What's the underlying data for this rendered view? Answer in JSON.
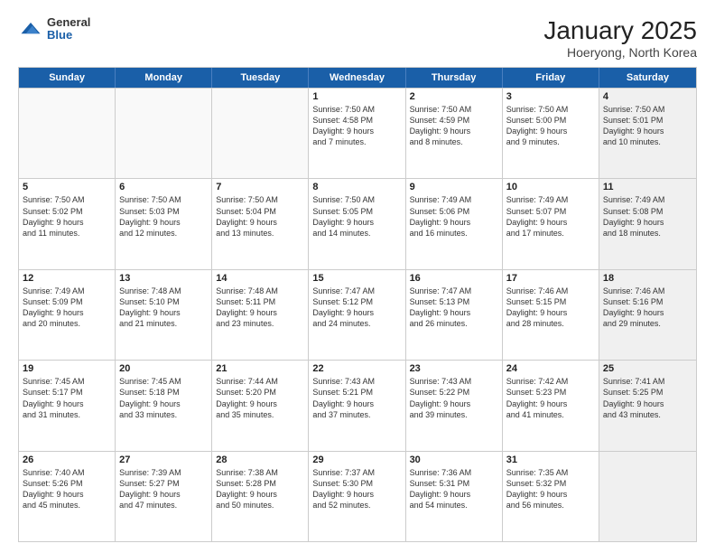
{
  "header": {
    "logo_general": "General",
    "logo_blue": "Blue",
    "title": "January 2025",
    "subtitle": "Hoeryong, North Korea"
  },
  "weekdays": [
    "Sunday",
    "Monday",
    "Tuesday",
    "Wednesday",
    "Thursday",
    "Friday",
    "Saturday"
  ],
  "weeks": [
    [
      {
        "day": "",
        "lines": [],
        "empty": true
      },
      {
        "day": "",
        "lines": [],
        "empty": true
      },
      {
        "day": "",
        "lines": [],
        "empty": true
      },
      {
        "day": "1",
        "lines": [
          "Sunrise: 7:50 AM",
          "Sunset: 4:58 PM",
          "Daylight: 9 hours",
          "and 7 minutes."
        ],
        "empty": false
      },
      {
        "day": "2",
        "lines": [
          "Sunrise: 7:50 AM",
          "Sunset: 4:59 PM",
          "Daylight: 9 hours",
          "and 8 minutes."
        ],
        "empty": false
      },
      {
        "day": "3",
        "lines": [
          "Sunrise: 7:50 AM",
          "Sunset: 5:00 PM",
          "Daylight: 9 hours",
          "and 9 minutes."
        ],
        "empty": false
      },
      {
        "day": "4",
        "lines": [
          "Sunrise: 7:50 AM",
          "Sunset: 5:01 PM",
          "Daylight: 9 hours",
          "and 10 minutes."
        ],
        "empty": false,
        "shaded": true
      }
    ],
    [
      {
        "day": "5",
        "lines": [
          "Sunrise: 7:50 AM",
          "Sunset: 5:02 PM",
          "Daylight: 9 hours",
          "and 11 minutes."
        ],
        "empty": false
      },
      {
        "day": "6",
        "lines": [
          "Sunrise: 7:50 AM",
          "Sunset: 5:03 PM",
          "Daylight: 9 hours",
          "and 12 minutes."
        ],
        "empty": false
      },
      {
        "day": "7",
        "lines": [
          "Sunrise: 7:50 AM",
          "Sunset: 5:04 PM",
          "Daylight: 9 hours",
          "and 13 minutes."
        ],
        "empty": false
      },
      {
        "day": "8",
        "lines": [
          "Sunrise: 7:50 AM",
          "Sunset: 5:05 PM",
          "Daylight: 9 hours",
          "and 14 minutes."
        ],
        "empty": false
      },
      {
        "day": "9",
        "lines": [
          "Sunrise: 7:49 AM",
          "Sunset: 5:06 PM",
          "Daylight: 9 hours",
          "and 16 minutes."
        ],
        "empty": false
      },
      {
        "day": "10",
        "lines": [
          "Sunrise: 7:49 AM",
          "Sunset: 5:07 PM",
          "Daylight: 9 hours",
          "and 17 minutes."
        ],
        "empty": false
      },
      {
        "day": "11",
        "lines": [
          "Sunrise: 7:49 AM",
          "Sunset: 5:08 PM",
          "Daylight: 9 hours",
          "and 18 minutes."
        ],
        "empty": false,
        "shaded": true
      }
    ],
    [
      {
        "day": "12",
        "lines": [
          "Sunrise: 7:49 AM",
          "Sunset: 5:09 PM",
          "Daylight: 9 hours",
          "and 20 minutes."
        ],
        "empty": false
      },
      {
        "day": "13",
        "lines": [
          "Sunrise: 7:48 AM",
          "Sunset: 5:10 PM",
          "Daylight: 9 hours",
          "and 21 minutes."
        ],
        "empty": false
      },
      {
        "day": "14",
        "lines": [
          "Sunrise: 7:48 AM",
          "Sunset: 5:11 PM",
          "Daylight: 9 hours",
          "and 23 minutes."
        ],
        "empty": false
      },
      {
        "day": "15",
        "lines": [
          "Sunrise: 7:47 AM",
          "Sunset: 5:12 PM",
          "Daylight: 9 hours",
          "and 24 minutes."
        ],
        "empty": false
      },
      {
        "day": "16",
        "lines": [
          "Sunrise: 7:47 AM",
          "Sunset: 5:13 PM",
          "Daylight: 9 hours",
          "and 26 minutes."
        ],
        "empty": false
      },
      {
        "day": "17",
        "lines": [
          "Sunrise: 7:46 AM",
          "Sunset: 5:15 PM",
          "Daylight: 9 hours",
          "and 28 minutes."
        ],
        "empty": false
      },
      {
        "day": "18",
        "lines": [
          "Sunrise: 7:46 AM",
          "Sunset: 5:16 PM",
          "Daylight: 9 hours",
          "and 29 minutes."
        ],
        "empty": false,
        "shaded": true
      }
    ],
    [
      {
        "day": "19",
        "lines": [
          "Sunrise: 7:45 AM",
          "Sunset: 5:17 PM",
          "Daylight: 9 hours",
          "and 31 minutes."
        ],
        "empty": false
      },
      {
        "day": "20",
        "lines": [
          "Sunrise: 7:45 AM",
          "Sunset: 5:18 PM",
          "Daylight: 9 hours",
          "and 33 minutes."
        ],
        "empty": false
      },
      {
        "day": "21",
        "lines": [
          "Sunrise: 7:44 AM",
          "Sunset: 5:20 PM",
          "Daylight: 9 hours",
          "and 35 minutes."
        ],
        "empty": false
      },
      {
        "day": "22",
        "lines": [
          "Sunrise: 7:43 AM",
          "Sunset: 5:21 PM",
          "Daylight: 9 hours",
          "and 37 minutes."
        ],
        "empty": false
      },
      {
        "day": "23",
        "lines": [
          "Sunrise: 7:43 AM",
          "Sunset: 5:22 PM",
          "Daylight: 9 hours",
          "and 39 minutes."
        ],
        "empty": false
      },
      {
        "day": "24",
        "lines": [
          "Sunrise: 7:42 AM",
          "Sunset: 5:23 PM",
          "Daylight: 9 hours",
          "and 41 minutes."
        ],
        "empty": false
      },
      {
        "day": "25",
        "lines": [
          "Sunrise: 7:41 AM",
          "Sunset: 5:25 PM",
          "Daylight: 9 hours",
          "and 43 minutes."
        ],
        "empty": false,
        "shaded": true
      }
    ],
    [
      {
        "day": "26",
        "lines": [
          "Sunrise: 7:40 AM",
          "Sunset: 5:26 PM",
          "Daylight: 9 hours",
          "and 45 minutes."
        ],
        "empty": false
      },
      {
        "day": "27",
        "lines": [
          "Sunrise: 7:39 AM",
          "Sunset: 5:27 PM",
          "Daylight: 9 hours",
          "and 47 minutes."
        ],
        "empty": false
      },
      {
        "day": "28",
        "lines": [
          "Sunrise: 7:38 AM",
          "Sunset: 5:28 PM",
          "Daylight: 9 hours",
          "and 50 minutes."
        ],
        "empty": false
      },
      {
        "day": "29",
        "lines": [
          "Sunrise: 7:37 AM",
          "Sunset: 5:30 PM",
          "Daylight: 9 hours",
          "and 52 minutes."
        ],
        "empty": false
      },
      {
        "day": "30",
        "lines": [
          "Sunrise: 7:36 AM",
          "Sunset: 5:31 PM",
          "Daylight: 9 hours",
          "and 54 minutes."
        ],
        "empty": false
      },
      {
        "day": "31",
        "lines": [
          "Sunrise: 7:35 AM",
          "Sunset: 5:32 PM",
          "Daylight: 9 hours",
          "and 56 minutes."
        ],
        "empty": false
      },
      {
        "day": "",
        "lines": [],
        "empty": true,
        "shaded": true
      }
    ]
  ]
}
